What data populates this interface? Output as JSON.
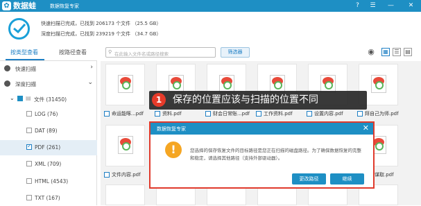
{
  "titlebar": {
    "logo_char": "✿",
    "app_name": "数据蛙",
    "app_sub": "数据恢复专家",
    "min": "—",
    "close": "✕"
  },
  "header": {
    "quick_scan": "快速扫描已完成，已找到 206173 个文件 （25.5 GB）",
    "deep_scan": "深度扫描已完成，已找到 239219 个文件 （34.7 GB）"
  },
  "tabs": {
    "type_view": "按类型查看",
    "path_view": "按路径查看"
  },
  "sidebar": {
    "quick": "快速扫描",
    "deep": "深度扫描",
    "items": [
      {
        "label": "文件 (31450)"
      },
      {
        "label": "LOG (76)"
      },
      {
        "label": "DAT (89)"
      },
      {
        "label": "PDF (261)"
      },
      {
        "label": "XML (709)"
      },
      {
        "label": "HTML (4543)"
      },
      {
        "label": "TXT (167)"
      }
    ]
  },
  "toolbar": {
    "search_placeholder": "在此输入文件名或路径搜索",
    "filter": "筛选器"
  },
  "files": {
    "row1": [
      "命运能啄...pdf",
      "资料.pdf",
      "财会日常账...pdf",
      "工作资料.pdf",
      "设置内容.pdf",
      "拜自己为师.pdf"
    ],
    "row2": [
      "文件内容.pdf",
      "倒阴谋取.pdf"
    ]
  },
  "callout": {
    "num": "1",
    "text": "保存的位置应该与扫描的位置不同"
  },
  "dialog": {
    "title": "数据恢复专家",
    "close": "✕",
    "line1": "您选择的保存恢复文件的目标路径是您正在扫描的磁盘路径。为了确保数据恢复的完整",
    "line2": "和稳定，请选择其他路径（支持外部驱动器）。",
    "change_path": "更改路径",
    "continue": "继续"
  },
  "colors": {
    "accent": "#1e8fc4",
    "highlight": "#e03a2c",
    "warning": "#f5a623"
  }
}
